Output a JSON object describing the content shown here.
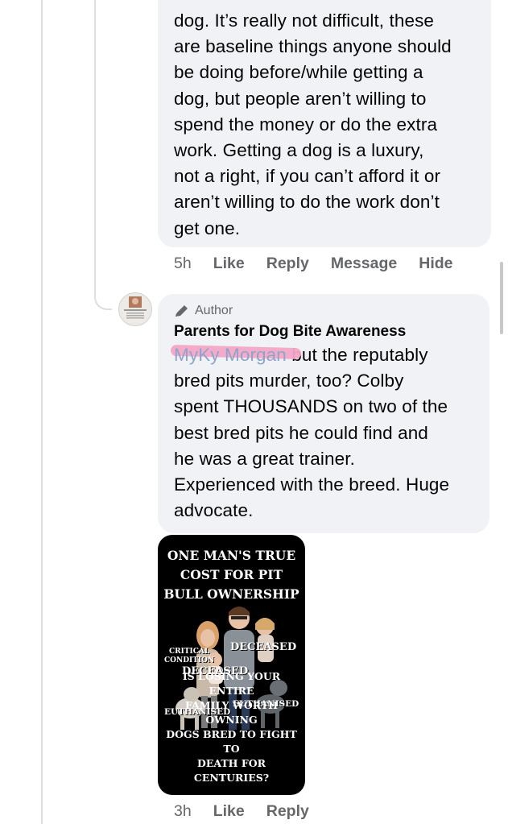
{
  "comment1": {
    "lines": [
      "dog. It’s really not difficult, these",
      "are baseline things anyone should",
      "be doing before/while getting a",
      "dog, but people aren’t willing to",
      "spend the money or do the extra",
      "work. Getting a dog is a luxury,",
      "not a right, if you can’t afford it or",
      "aren’t willing to do the work don’t",
      "get one."
    ],
    "time": "5h",
    "actions": {
      "like": "Like",
      "reply": "Reply",
      "message": "Message",
      "hide": "Hide"
    }
  },
  "comment2": {
    "badge": "Author",
    "author": "Parents for Dog Bite Awareness",
    "mention": "MyKy Morgan",
    "first_line_rest": " but the reputably",
    "lines": [
      "bred pits murder, too? Colby",
      "spent THOUSANDS on two of the",
      "best bred pits he could find and",
      "he was a great trainer.",
      "Experienced with the breed. Huge",
      "advocate."
    ],
    "image": {
      "title": [
        "ONE MAN'S TRUE",
        "COST FOR PIT",
        "BULL OWNERSHIP"
      ],
      "labels": {
        "critical": [
          "CRITICAL",
          "CONDITION"
        ],
        "deceased1": "DECEASED",
        "deceased2": "DECEASED",
        "euthanised1": "EUTHANISED",
        "euthanised2": "EUTHANISED"
      },
      "question": [
        "IS LOSING YOUR ENTIRE",
        "FAMILY WORTH OWNING",
        "DOGS BRED TO FIGHT TO",
        "DEATH FOR CENTURIES?"
      ]
    },
    "time": "3h",
    "actions": {
      "like": "Like",
      "reply": "Reply"
    }
  },
  "colors": {
    "bubble": "#f0f2f5",
    "meta": "#65676b",
    "mention_highlight": "#f3a7c7"
  }
}
